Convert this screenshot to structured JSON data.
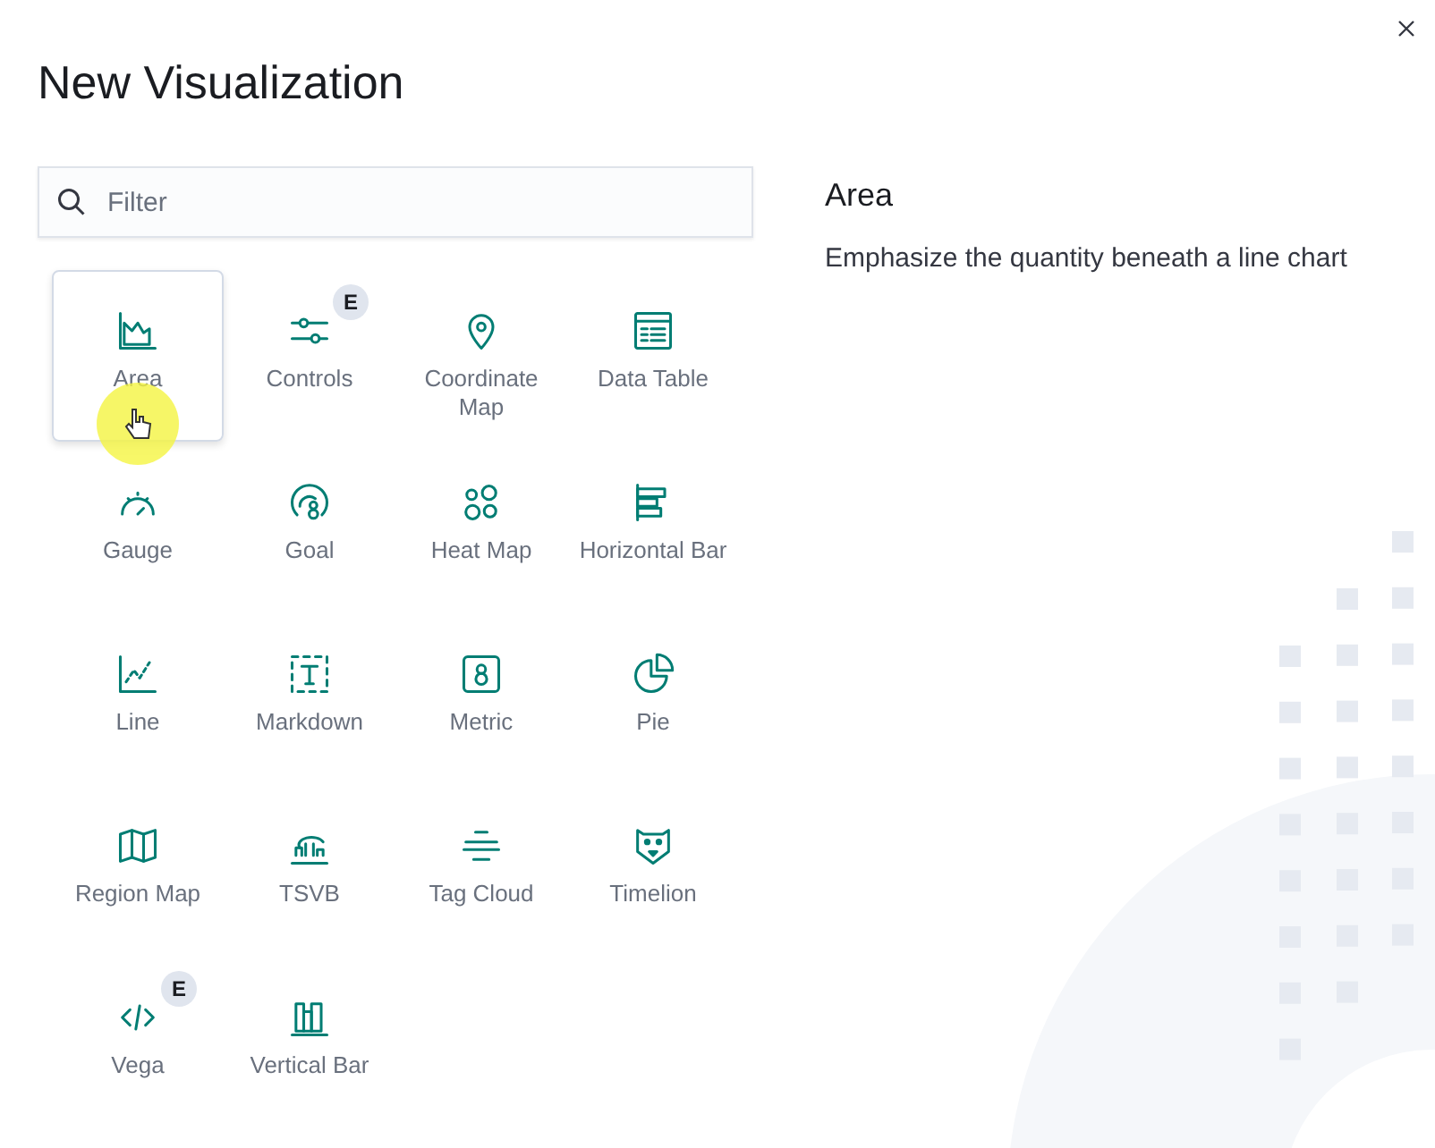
{
  "title": "New Visualization",
  "filter": {
    "placeholder": "Filter"
  },
  "items": [
    {
      "label": "Area",
      "kind": "area",
      "selected": true
    },
    {
      "label": "Controls",
      "kind": "controls",
      "selected": false,
      "badge": "E"
    },
    {
      "label": "Coordinate Map",
      "kind": "coordinate_map",
      "selected": false
    },
    {
      "label": "Data Table",
      "kind": "data_table",
      "selected": false
    },
    {
      "label": "Gauge",
      "kind": "gauge",
      "selected": false
    },
    {
      "label": "Goal",
      "kind": "goal",
      "selected": false
    },
    {
      "label": "Heat Map",
      "kind": "heat_map",
      "selected": false
    },
    {
      "label": "Horizontal Bar",
      "kind": "horizontal_bar",
      "selected": false
    },
    {
      "label": "Line",
      "kind": "line",
      "selected": false
    },
    {
      "label": "Markdown",
      "kind": "markdown",
      "selected": false
    },
    {
      "label": "Metric",
      "kind": "metric",
      "selected": false
    },
    {
      "label": "Pie",
      "kind": "pie",
      "selected": false
    },
    {
      "label": "Region Map",
      "kind": "region_map",
      "selected": false
    },
    {
      "label": "TSVB",
      "kind": "tsvb",
      "selected": false
    },
    {
      "label": "Tag Cloud",
      "kind": "tag_cloud",
      "selected": false
    },
    {
      "label": "Timelion",
      "kind": "timelion",
      "selected": false
    },
    {
      "label": "Vega",
      "kind": "vega",
      "selected": false,
      "badge": "E"
    },
    {
      "label": "Vertical Bar",
      "kind": "vertical_bar",
      "selected": false
    }
  ],
  "description": {
    "title": "Area",
    "text": "Emphasize the quantity beneath a line chart"
  }
}
